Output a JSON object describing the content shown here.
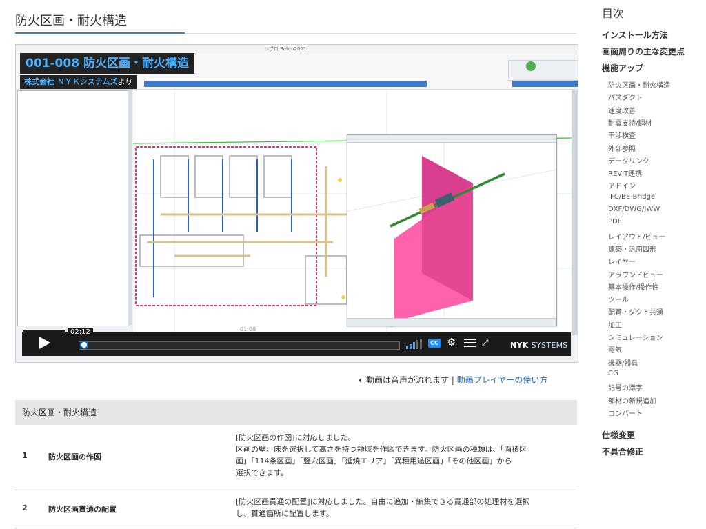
{
  "page": {
    "title": "防火区画・耐火構造"
  },
  "video": {
    "overlay_title": "001-008 防火区画・耐火構造",
    "overlay_sub_company": "株式会社 ＮＹＫシステムズ",
    "overlay_sub_suffix": "より",
    "app_title": "レブロ Rebro2021",
    "time": "02:12",
    "current_seconds": 132,
    "progress_fraction": 0.0,
    "cad_timestamp": "01:08",
    "brand_bold": "NYK",
    "brand_rest": "SYSTEMS",
    "colors": {
      "accent": "#4ab0ff",
      "cc": "#1a8cff"
    }
  },
  "audio_note": {
    "icon": "speaker-icon",
    "text": "動画は音声が流れます",
    "separator": "|",
    "link": "動画プレイヤーの使い方"
  },
  "table": {
    "header": "防火区画・耐火構造",
    "rows": [
      {
        "num": "1",
        "name": "防火区画の作図",
        "desc_lines": [
          "[防火区画の作図]に対応しました。",
          "区画の壁、床を選択して高さを持つ領域を作図できます。防火区画の種類は、「面積区",
          "画」「114条区画」「竪穴区画」「延焼エリア」「異種用途区画」「その他区画」から",
          "選択できます。"
        ]
      },
      {
        "num": "2",
        "name": "防火区画貫通の配置",
        "desc_lines": [
          "[防火区画貫通の配置]に対応しました。自由に追加・編集できる貫通部の処理材を選択",
          "し、貫通箇所に配置します。"
        ]
      }
    ]
  },
  "toc": {
    "title": "目次",
    "major": [
      "インストール方法",
      "画面周りの主な変更点",
      "機能アップ"
    ],
    "minor": [
      "防火区画・耐火構造",
      "パスダクト",
      "速度改善",
      "耐震支持/鋼材",
      "干渉検査",
      "外部参照",
      "データリンク",
      "REVIT連携",
      "アドイン",
      "IFC/BE-Bridge",
      "DXF/DWG/JWW",
      "PDF",
      "レイアウト/ビュー",
      "建築・汎用図形",
      "レイヤー",
      "アラウンドビュー",
      "基本操作/操作性",
      "ツール",
      "配管・ダクト共通",
      "加工",
      "シミュレーション",
      "電気",
      "機器/器具",
      "CG",
      "記号の添字",
      "部材の新規追加",
      "コンバート"
    ],
    "tail": [
      "仕様変更",
      "不具合修正"
    ]
  }
}
